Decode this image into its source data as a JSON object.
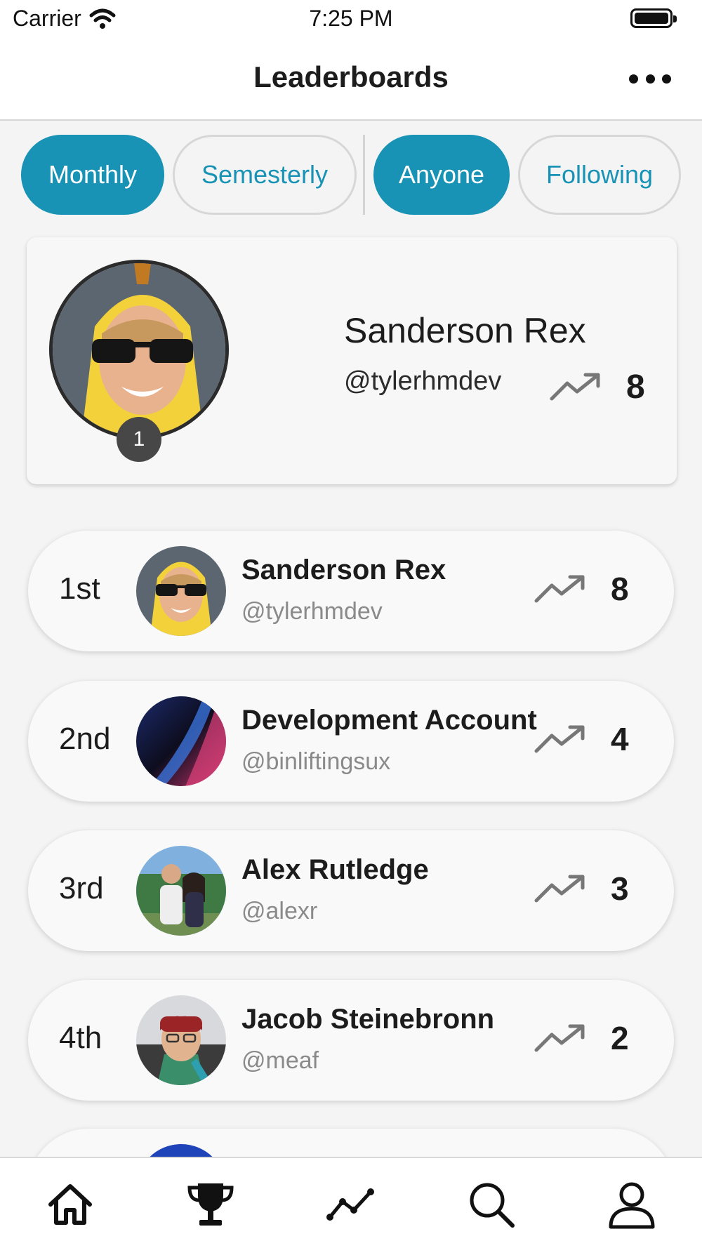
{
  "status_bar": {
    "carrier": "Carrier",
    "time": "7:25 PM"
  },
  "nav": {
    "title": "Leaderboards",
    "more_icon": "ellipsis-icon"
  },
  "filters": {
    "period": [
      {
        "label": "Monthly",
        "active": true
      },
      {
        "label": "Semesterly",
        "active": false
      }
    ],
    "audience": [
      {
        "label": "Anyone",
        "active": true
      },
      {
        "label": "Following",
        "active": false
      }
    ]
  },
  "highlight": {
    "rank": "1",
    "name": "Sanderson Rex",
    "handle": "@tylerhmdev",
    "score": "8",
    "trend_icon": "trending-up-icon"
  },
  "rankings": [
    {
      "place": "1st",
      "name": "Sanderson Rex",
      "handle": "@tylerhmdev",
      "score": "8"
    },
    {
      "place": "2nd",
      "name": "Development Account",
      "handle": "@binliftingsux",
      "score": "4"
    },
    {
      "place": "3rd",
      "name": "Alex Rutledge",
      "handle": "@alexr",
      "score": "3"
    },
    {
      "place": "4th",
      "name": "Jacob Steinebronn",
      "handle": "@meaf",
      "score": "2"
    }
  ],
  "tab_bar": [
    "home-icon",
    "trophy-icon",
    "activity-chart-icon",
    "search-icon",
    "profile-icon"
  ],
  "colors": {
    "accent": "#1893b5",
    "badge": "#474747",
    "trend": "#777777"
  }
}
